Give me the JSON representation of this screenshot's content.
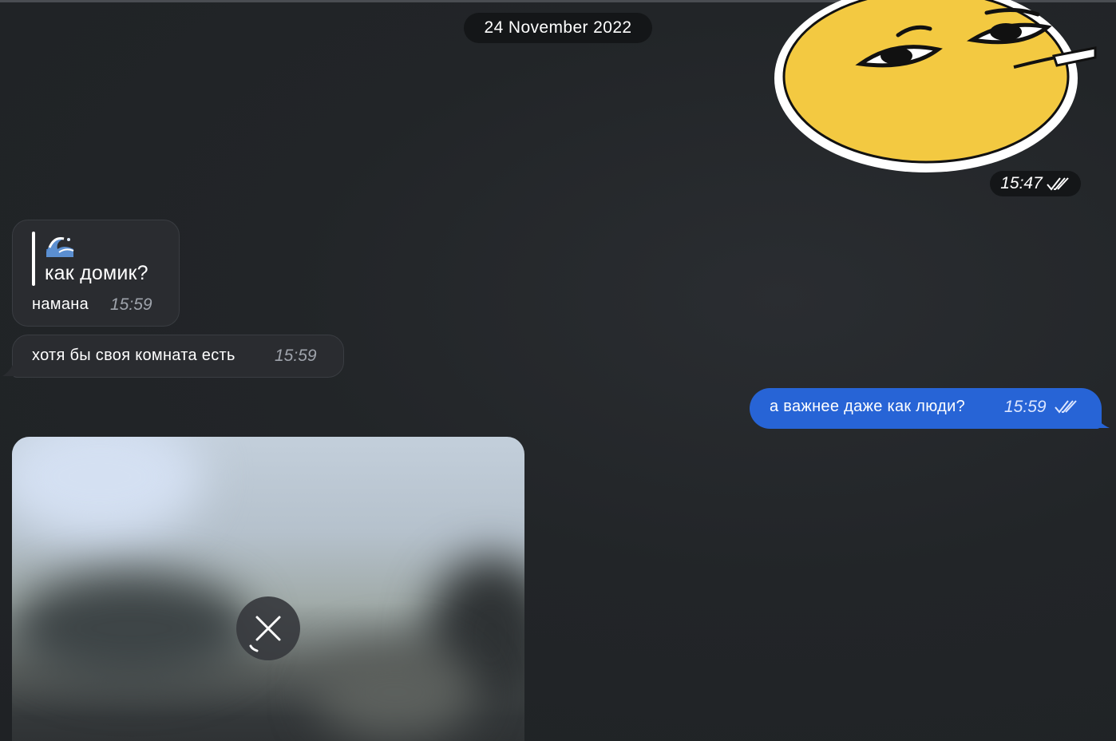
{
  "date_separator": "24 November 2022",
  "sticker": {
    "icon": "smirking-face-sticker",
    "time": "15:47",
    "status": "read"
  },
  "messages": [
    {
      "direction": "incoming",
      "reply_quote": {
        "emoji_icon": "wave-emoji",
        "text": "как домик?"
      },
      "text": "намана",
      "time": "15:59"
    },
    {
      "direction": "incoming",
      "text": "хотя бы своя комната есть",
      "time": "15:59"
    },
    {
      "direction": "outgoing",
      "text": "а важнее даже как люди?",
      "time": "15:59",
      "status": "read"
    }
  ],
  "photo": {
    "state": "uploading",
    "cancel_icon": "close-icon"
  },
  "colors": {
    "background": "#222528",
    "incoming_bubble": "#2a2c30",
    "outgoing_bubble": "#2764d6",
    "pill": "#141618",
    "sticker_face": "#f3c941"
  }
}
